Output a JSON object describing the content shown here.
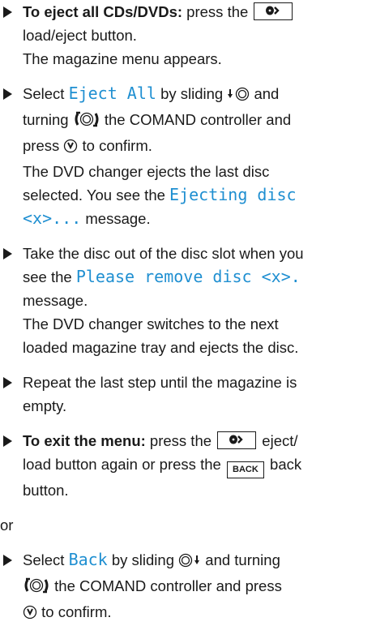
{
  "step1": {
    "lead": "To eject all CDs/DVDs:",
    "text_before": " press the ",
    "button_icon": "eject-load-icon",
    "line2": "load/eject button.",
    "result": "The magazine menu appears."
  },
  "step2": {
    "select": "Select ",
    "menu_item": "Eject All",
    "sliding": " by sliding ",
    "and": " and",
    "turning": "turning ",
    "controller": " the COMAND controller and",
    "press": "press ",
    "confirm": " to confirm.",
    "result1": "The DVD changer ejects the last disc",
    "result2": "selected. You see the ",
    "msg1": "Ejecting disc",
    "msg2": "<x>...",
    "result3": " message."
  },
  "step3": {
    "line1": "Take the disc out of the disc slot when you",
    "line2": "see the ",
    "msg": "Please remove disc <x>.",
    "line3": "message.",
    "result1": "The DVD changer switches to the next",
    "result2": "loaded magazine tray and ejects the disc."
  },
  "step4": {
    "line1": "Repeat the last step until the magazine is",
    "line2": "empty."
  },
  "step5": {
    "lead": "To exit the menu:",
    "text1": " press the ",
    "text2": " eject/",
    "line2a": "load button again or press the ",
    "back_label": "BACK",
    "line2b": " back",
    "line3": "button."
  },
  "or": "or",
  "step6": {
    "select": "Select ",
    "menu_item": "Back",
    "sliding": " by sliding ",
    "and": " and turning",
    "controller": " the COMAND controller and press",
    "confirm": " to confirm."
  },
  "icons": {
    "eject": "eject-load-icon",
    "slide_down": "slide-down-icon",
    "turn": "turn-controller-icon",
    "press": "press-controller-icon",
    "back": "back-button-icon"
  },
  "colors": {
    "display_text": "#1f8fd1",
    "text": "#1a1a1a"
  }
}
